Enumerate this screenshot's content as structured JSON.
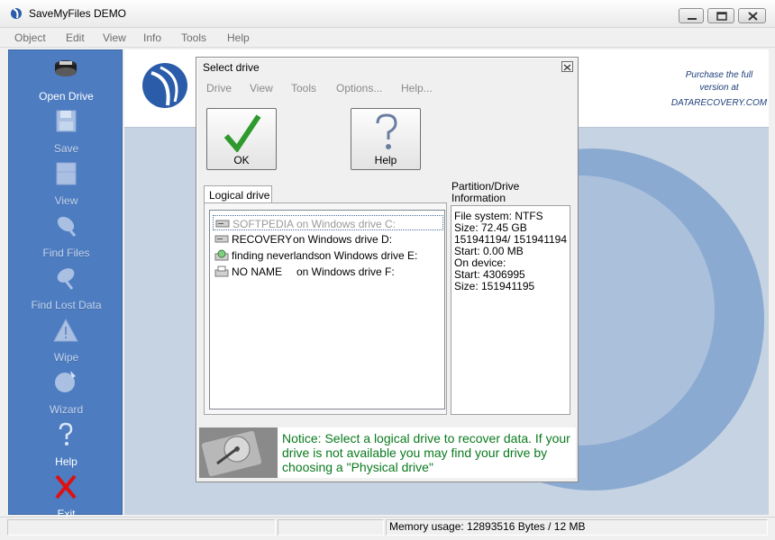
{
  "window": {
    "title": "SaveMyFiles  DEMO"
  },
  "menubar": [
    "Object",
    "Edit",
    "View",
    "Info",
    "Tools",
    "Help"
  ],
  "sidebar": {
    "items": [
      {
        "label": "Open Drive",
        "icon": "drive-icon",
        "enabled": true
      },
      {
        "label": "Save",
        "icon": "floppy-icon",
        "enabled": false
      },
      {
        "label": "View",
        "icon": "view-icon",
        "enabled": false
      },
      {
        "label": "Find Files",
        "icon": "find-files-icon",
        "enabled": false
      },
      {
        "label": "Find Lost Data",
        "icon": "find-lost-data-icon",
        "enabled": false
      },
      {
        "label": "Wipe",
        "icon": "warning-icon",
        "enabled": false
      },
      {
        "label": "Wizard",
        "icon": "wizard-icon",
        "enabled": false
      },
      {
        "label": "Help",
        "icon": "question-icon",
        "enabled": true
      },
      {
        "label": "Exit",
        "icon": "exit-icon",
        "enabled": true
      }
    ]
  },
  "banner": {
    "promo_line1": "Purchase the full",
    "promo_line2": "version at",
    "promo_url": "DATARECOVERY.COM"
  },
  "dialog": {
    "title": "Select drive",
    "menu": [
      "Drive",
      "View",
      "Tools",
      "Options...",
      "Help..."
    ],
    "ok_label": "OK",
    "help_label": "Help",
    "tab_label": "Logical drive",
    "drives": [
      {
        "name": "SOFTPEDIA",
        "location": "on Windows drive C:"
      },
      {
        "name": "RECOVERY",
        "location": "on Windows drive D:"
      },
      {
        "name": "finding neverlands",
        "location": "on Windows drive E:"
      },
      {
        "name": "NO NAME",
        "location": "on Windows drive F:"
      }
    ],
    "info_title_line1": "Partition/Drive",
    "info_title_line2": "Information",
    "info_lines": [
      "File system: NTFS",
      "Size: 72.45 GB",
      "151941194/ 151941194",
      "Start: 0.00 MB",
      "On device:",
      "Start:  4306995",
      "Size: 151941195"
    ],
    "notice": "Notice: Select a logical  drive to recover data. If your drive is not available you may find your drive by choosing a \"Physical drive\"",
    "notice_color": "#0a7a1e"
  },
  "status": {
    "memory": "Memory usage: 12893516 Bytes / 12 MB"
  },
  "colors": {
    "sidebar": "#4d7cc1",
    "main_bg": "#c6d3e2"
  }
}
